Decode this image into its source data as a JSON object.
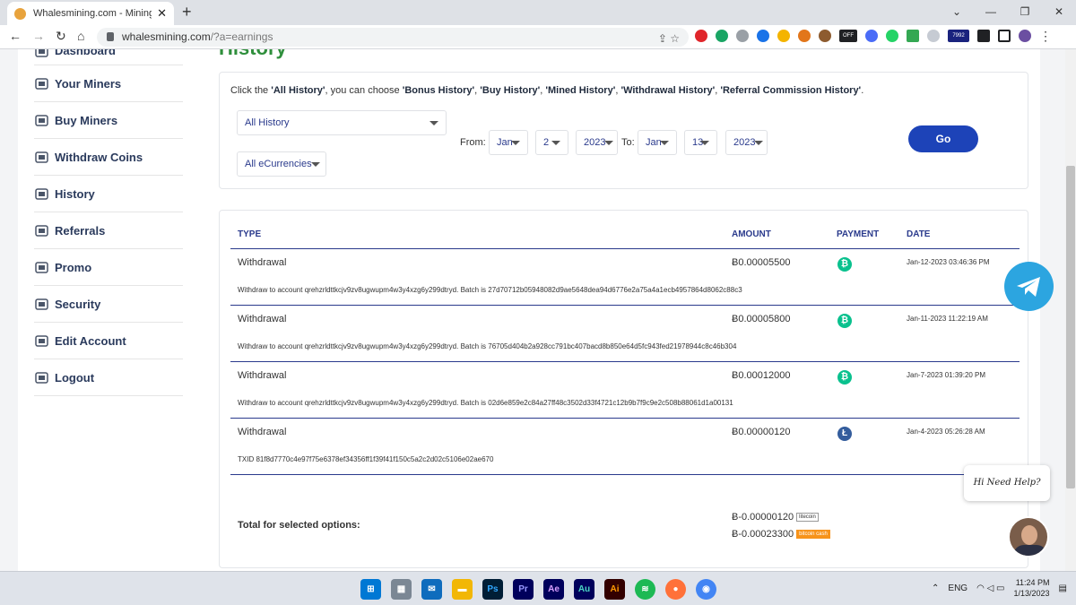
{
  "browser": {
    "tab_title": "Whalesmining.com - Mining Bitc",
    "url_host": "whalesmining.com",
    "url_path": "/?a=earnings",
    "badge_off": "OFF",
    "badge_count": "7992"
  },
  "sidebar": {
    "items": [
      {
        "label": "Dashboard",
        "icon": "dashboard-icon"
      },
      {
        "label": "Your Miners",
        "icon": "miners-icon"
      },
      {
        "label": "Buy Miners",
        "icon": "location-pin-icon"
      },
      {
        "label": "Withdraw Coins",
        "icon": "withdraw-icon"
      },
      {
        "label": "History",
        "icon": "history-icon"
      },
      {
        "label": "Referrals",
        "icon": "referrals-icon"
      },
      {
        "label": "Promo",
        "icon": "promo-icon"
      },
      {
        "label": "Security",
        "icon": "security-icon"
      },
      {
        "label": "Edit Account",
        "icon": "edit-account-icon"
      },
      {
        "label": "Logout",
        "icon": "logout-icon"
      }
    ]
  },
  "page": {
    "heading": "History"
  },
  "filters": {
    "note_prefix": "Click the ",
    "note_all": "'All History'",
    "note_mid": ", you can choose ",
    "note_bonus": "'Bonus History'",
    "note_buy": "'Buy History'",
    "note_mined": "'Mined History'",
    "note_withdrawal": "'Withdrawal History'",
    "note_referral": "'Referral Commission History'",
    "history_type": "All History",
    "currency": "All eCurrencies",
    "from_label": "From:",
    "from_month": "Jan",
    "from_day": "2",
    "from_year": "2023",
    "to_label": "To:",
    "to_month": "Jan",
    "to_day": "13",
    "to_year": "2023",
    "go_label": "Go"
  },
  "table": {
    "headers": {
      "type": "TYPE",
      "amount": "AMOUNT",
      "payment": "PAYMENT",
      "date": "DATE"
    },
    "rows": [
      {
        "type": "Withdrawal",
        "amount": "Ƀ0.00005500",
        "payment": "bitcoin-cash-icon",
        "date": "Jan-12-2023 03:46:36 PM",
        "desc": "Withdraw to account qrehzrldttkcjv9zv8ugwupm4w3y4xzg6y299dtryd. Batch is 27d70712b05948082d9ae5648dea94d6776e2a75a4a1ecb4957864d8062c88c3"
      },
      {
        "type": "Withdrawal",
        "amount": "Ƀ0.00005800",
        "payment": "bitcoin-cash-icon",
        "date": "Jan-11-2023 11:22:19 AM",
        "desc": "Withdraw to account qrehzrldttkcjv9zv8ugwupm4w3y4xzg6y299dtryd. Batch is 76705d404b2a928cc791bc407bacd8b850e64d5fc943fed21978944c8c46b304"
      },
      {
        "type": "Withdrawal",
        "amount": "Ƀ0.00012000",
        "payment": "bitcoin-cash-icon",
        "date": "Jan-7-2023 01:39:20 PM",
        "desc": "Withdraw to account qrehzrldttkcjv9zv8ugwupm4w3y4xzg6y299dtryd. Batch is 02d6e859e2c84a27ff48c3502d33f4721c12b9b7f9c9e2c508b88061d1a00131"
      },
      {
        "type": "Withdrawal",
        "amount": "Ƀ0.00000120",
        "payment": "litecoin-icon",
        "date": "Jan-4-2023 05:26:28 AM",
        "desc": "TXID 81f8d7770c4e97f75e6378ef34356ff1f39f41f150c5a2c2d02c5106e02ae670"
      }
    ],
    "total_label": "Total for selected options:",
    "totals": [
      {
        "value": "Ƀ-0.00000120",
        "badge": "litecoin"
      },
      {
        "value": "Ƀ-0.00023300",
        "badge": "bitcoin cash"
      }
    ]
  },
  "widgets": {
    "help_text": "Hi Need Help?"
  },
  "taskbar": {
    "apps": [
      "Ps",
      "Pr",
      "Ae",
      "Au",
      "Ai"
    ],
    "lang": "ENG",
    "time": "11:24 PM",
    "date": "1/13/2023"
  }
}
